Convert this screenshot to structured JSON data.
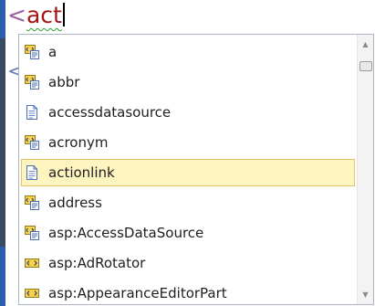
{
  "editor": {
    "lt": "<",
    "typed": "act",
    "bg_lt": "<"
  },
  "completion": {
    "items": [
      {
        "label": "a",
        "icon": "html-element-icon"
      },
      {
        "label": "abbr",
        "icon": "html-element-icon"
      },
      {
        "label": "accessdatasource",
        "icon": "snippet-icon"
      },
      {
        "label": "acronym",
        "icon": "html-element-icon"
      },
      {
        "label": "actionlink",
        "icon": "snippet-icon",
        "selected": true
      },
      {
        "label": "address",
        "icon": "html-element-icon"
      },
      {
        "label": "asp:AccessDataSource",
        "icon": "html-element-icon"
      },
      {
        "label": "asp:AdRotator",
        "icon": "asp-control-icon"
      },
      {
        "label": "asp:AppearanceEditorPart",
        "icon": "asp-control-icon"
      }
    ],
    "scroll": {
      "up_glyph": "▲",
      "down_glyph": "▼"
    }
  },
  "colors": {
    "selection_bg": "#fdf4bf",
    "selection_border": "#e5c365",
    "tag_text": "#a31515",
    "squiggle": "#2fa02f"
  }
}
